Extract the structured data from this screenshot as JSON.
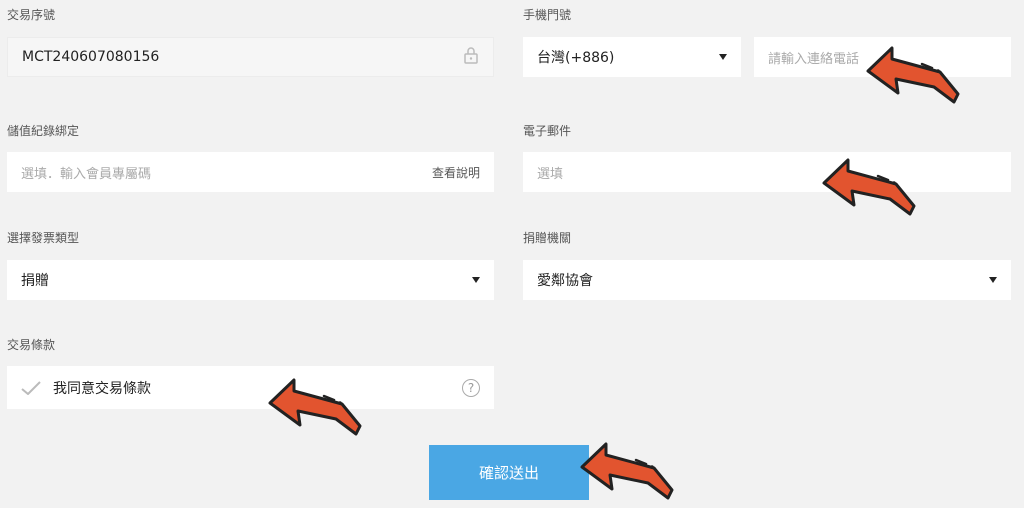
{
  "form": {
    "txn_no": {
      "label": "交易序號",
      "value": "MCT240607080156"
    },
    "phone": {
      "label": "手機門號",
      "country": "台灣(+886)",
      "placeholder": "請輸入連絡電話"
    },
    "stored_value": {
      "label": "儲值紀錄綁定",
      "placeholder": "選填．輸入會員專屬碼",
      "help": "查看說明"
    },
    "email": {
      "label": "電子郵件",
      "placeholder": "選填"
    },
    "invoice_type": {
      "label": "選擇發票類型",
      "value": "捐贈"
    },
    "donate_org": {
      "label": "捐贈機關",
      "value": "愛鄰協會"
    },
    "terms": {
      "label": "交易條款",
      "checkbox": "我同意交易條款",
      "help_icon": "?"
    },
    "submit": "確認送出"
  },
  "colors": {
    "accent": "#4aa7e4",
    "arrow": "#e2542f",
    "background": "#f2f2f2"
  },
  "icons": [
    "lock-icon",
    "checkmark-icon",
    "question-icon",
    "caret-down-icon",
    "pointer-arrow-icon"
  ]
}
